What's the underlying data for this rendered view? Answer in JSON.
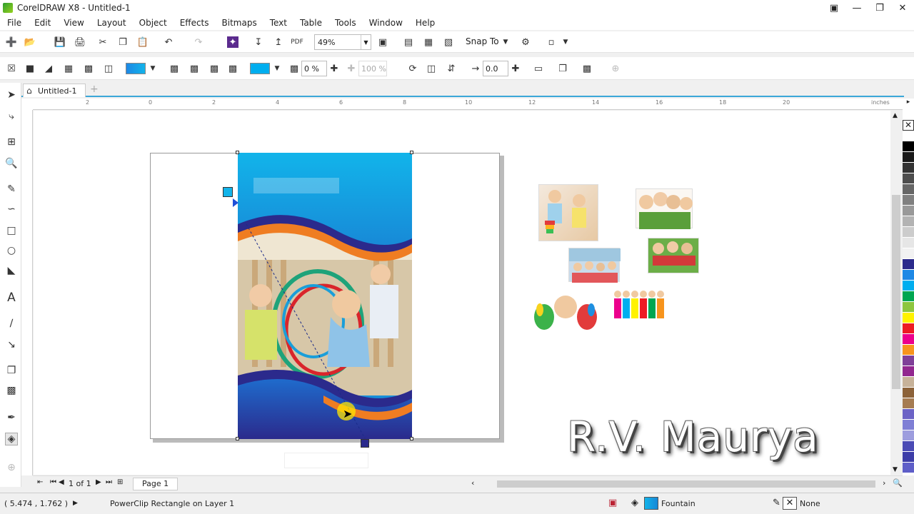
{
  "window": {
    "title": "CorelDRAW X8 - Untitled-1",
    "min_icon": "minimize-icon",
    "max_icon": "restore-icon",
    "close_icon": "close-icon"
  },
  "menu": [
    "File",
    "Edit",
    "View",
    "Layout",
    "Object",
    "Effects",
    "Bitmaps",
    "Text",
    "Table",
    "Tools",
    "Window",
    "Help"
  ],
  "toolbar": {
    "zoom_value": "49%",
    "snap_label": "Snap To",
    "transparency_value": "0 %",
    "opacity_value": "100 %",
    "nudge_value": "0.0"
  },
  "tabs": {
    "document": "Untitled-1"
  },
  "ruler": {
    "unit": "inches",
    "h_labels": [
      "2",
      "0",
      "2",
      "4",
      "6",
      "8",
      "10",
      "12",
      "14",
      "16",
      "18",
      "20"
    ]
  },
  "canvas": {
    "watermark": "R.V. Maurya",
    "flyer_color_top": "#12b4ea",
    "flyer_color_bottom": "#1887d6",
    "wave_orange": "#ef7d22",
    "wave_navy": "#2b2a8c"
  },
  "pagebar": {
    "page_counter": "1 of 1",
    "page_tab": "Page 1"
  },
  "status": {
    "coords": "( 5.474 , 1.762 )",
    "selection": "PowerClip Rectangle on Layer 1",
    "fill_label": "Fountain",
    "outline_label": "None"
  },
  "palette_colors": [
    "#ffffff",
    "#000000",
    "#1a1a1a",
    "#333333",
    "#4d4d4d",
    "#666666",
    "#808080",
    "#999999",
    "#b3b3b3",
    "#cccccc",
    "#e6e6e6",
    "#f2f2f2",
    "#2b2a8c",
    "#1e88e5",
    "#00aeef",
    "#00a651",
    "#8dc63f",
    "#fff200",
    "#ed1c24",
    "#ec008c",
    "#f7941d",
    "#7f3f98",
    "#92278f",
    "#c7b299",
    "#8c6239",
    "#a67c52",
    "#6c63c6",
    "#7f7fd5",
    "#9d9dde",
    "#4b4bb5",
    "#3d3da8",
    "#5e5ec8"
  ]
}
